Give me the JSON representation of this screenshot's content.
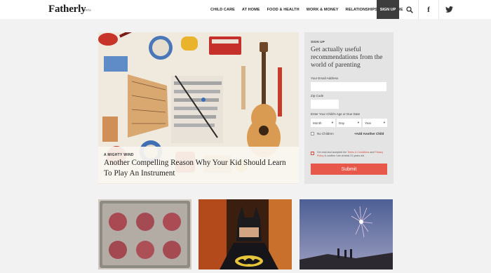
{
  "header": {
    "logo": "Fatherly",
    "logo_suffix": "beta",
    "nav": [
      "CHILD CARE",
      "AT HOME",
      "FOOD & HEALTH",
      "WORK & MONEY",
      "RELATIONSHIPS",
      "CULTURE"
    ],
    "signup": "SIGN UP",
    "icons": [
      "search-icon",
      "facebook-icon",
      "twitter-icon"
    ]
  },
  "hero": {
    "kicker": "A MIGHTY WIND",
    "title": "Another Compelling Reason Why Your Kid Should Learn To Play An Instrument"
  },
  "signup_form": {
    "label": "SIGN UP",
    "heading": "Get actually useful recommendations from the world of parenting",
    "email_label": "Your Email Address",
    "zip_label": "Zip Code",
    "age_label": "Enter Your Child's Age or Due Date",
    "month": "Month",
    "day": "Day",
    "year": "Year",
    "no_children": "No Children",
    "add_child": "+Add Another Child",
    "terms_pre": "I've read and accepted the ",
    "terms_link": "Terms & Conditions",
    "terms_mid": " and ",
    "privacy_link": "Privacy Policy",
    "terms_post": " & confirm I am at least 21 years old.",
    "terms_checked": true,
    "no_children_checked": false,
    "submit": "Submit"
  },
  "colors": {
    "accent": "#e8584a",
    "signup_bg": "#3d3d3d",
    "panel_bg": "#e4e4e4",
    "page_bg": "#f2f2f2"
  }
}
